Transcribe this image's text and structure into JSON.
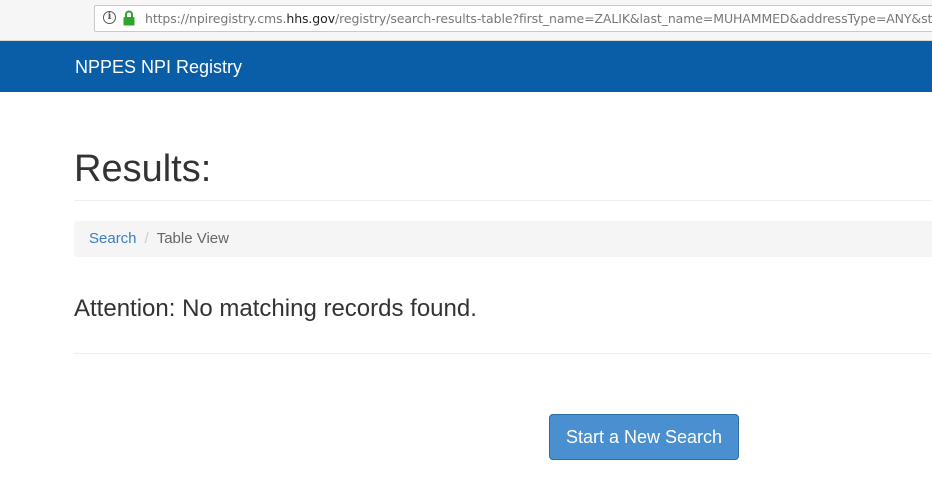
{
  "browser": {
    "url_prefix": "https://npiregistry.cms.",
    "url_domain": "hhs.gov",
    "url_suffix": "/registry/search-results-table?first_name=ZALIK&last_name=MUHAMMED&addressType=ANY&state=FL",
    "info_glyph": "i"
  },
  "navbar": {
    "brand": "NPPES NPI Registry"
  },
  "main": {
    "title": "Results:",
    "breadcrumb": {
      "link": "Search",
      "separator": "/",
      "active": "Table View"
    },
    "attention": "Attention: No matching records found.",
    "new_search_button": "Start a New Search"
  },
  "colors": {
    "navbar": "#0a5ea8",
    "button": "#4a8fd0",
    "link": "#3a7fc1",
    "lock": "#2fa52f"
  },
  "icons": [
    "info-icon",
    "lock-icon"
  ]
}
